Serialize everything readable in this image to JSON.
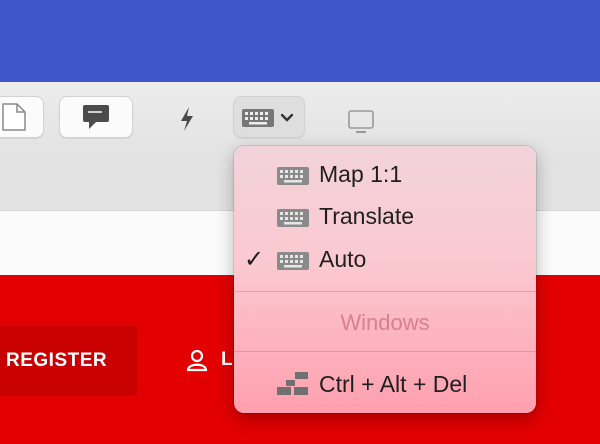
{
  "page": {
    "register_label": "REGISTER",
    "login_label": "L"
  },
  "menu": {
    "items": [
      {
        "label": "Map 1:1",
        "checked": false,
        "icon": "keyboard-icon"
      },
      {
        "label": "Translate",
        "checked": false,
        "icon": "keyboard-icon"
      },
      {
        "label": "Auto",
        "checked": true,
        "icon": "keyboard-icon"
      }
    ],
    "check_glyph": "✓",
    "section_title": "Windows",
    "ctrl_alt_del_label": "Ctrl + Alt + Del"
  },
  "colors": {
    "top_band": "#3e56c9",
    "toolbar": "#e6e6e6",
    "red": "#e30000",
    "register_bg": "#c90000",
    "menu_bg_top": "#f2d3da",
    "menu_bg_bottom": "#ff9fae",
    "section_title": "#d8808c"
  }
}
